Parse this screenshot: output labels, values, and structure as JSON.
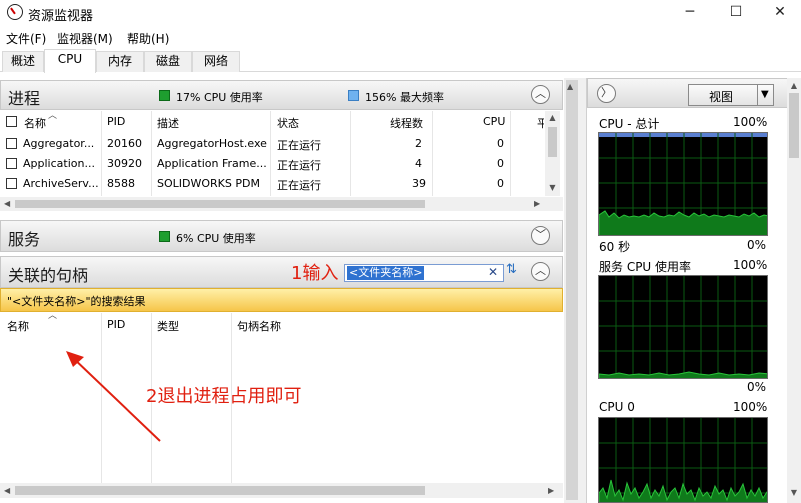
{
  "window": {
    "title": "资源监视器",
    "minimize": "─",
    "maximize": "☐",
    "close": "✕"
  },
  "menu": [
    "文件(F)",
    "监视器(M)",
    "帮助(H)"
  ],
  "tabs": [
    "概述",
    "CPU",
    "内存",
    "磁盘",
    "网络"
  ],
  "active_tab": "CPU",
  "processes": {
    "title": "进程",
    "cpu_usage": "17% CPU 使用率",
    "max_freq": "156% 最大频率",
    "columns": [
      "名称",
      "PID",
      "描述",
      "状态",
      "线程数",
      "CPU",
      "平"
    ],
    "rows": [
      {
        "name": "Aggregator...",
        "pid": "20160",
        "desc": "AggregatorHost.exe",
        "status": "正在运行",
        "threads": "2",
        "cpu": "0"
      },
      {
        "name": "Application...",
        "pid": "30920",
        "desc": "Application Frame...",
        "status": "正在运行",
        "threads": "4",
        "cpu": "0"
      },
      {
        "name": "ArchiveServ...",
        "pid": "8588",
        "desc": "SOLIDWORKS PDM",
        "status": "正在运行",
        "threads": "39",
        "cpu": "0"
      }
    ]
  },
  "services": {
    "title": "服务",
    "cpu_usage": "6% CPU 使用率"
  },
  "handles": {
    "title": "关联的句柄",
    "search_value": "<文件夹名称>",
    "result_text": "\"<文件夹名称>\"的搜索结果",
    "columns": [
      "名称",
      "PID",
      "类型",
      "句柄名称"
    ]
  },
  "annotations": {
    "step1": "1输入",
    "step2": "2退出进程占用即可",
    "color": "#e02010"
  },
  "right": {
    "view_button": "视图",
    "graphs": [
      {
        "title": "CPU - 总计",
        "max": "100%",
        "xlabel": "60 秒",
        "min": "0%"
      },
      {
        "title": "服务 CPU 使用率",
        "max": "100%",
        "min": "0%"
      },
      {
        "title": "CPU 0",
        "max": "100%"
      }
    ]
  },
  "colors": {
    "graph_line": "#29c43a",
    "graph_fill": "#0f7a1b",
    "grid": "#0a5a12",
    "selection": "#2f72d0"
  }
}
